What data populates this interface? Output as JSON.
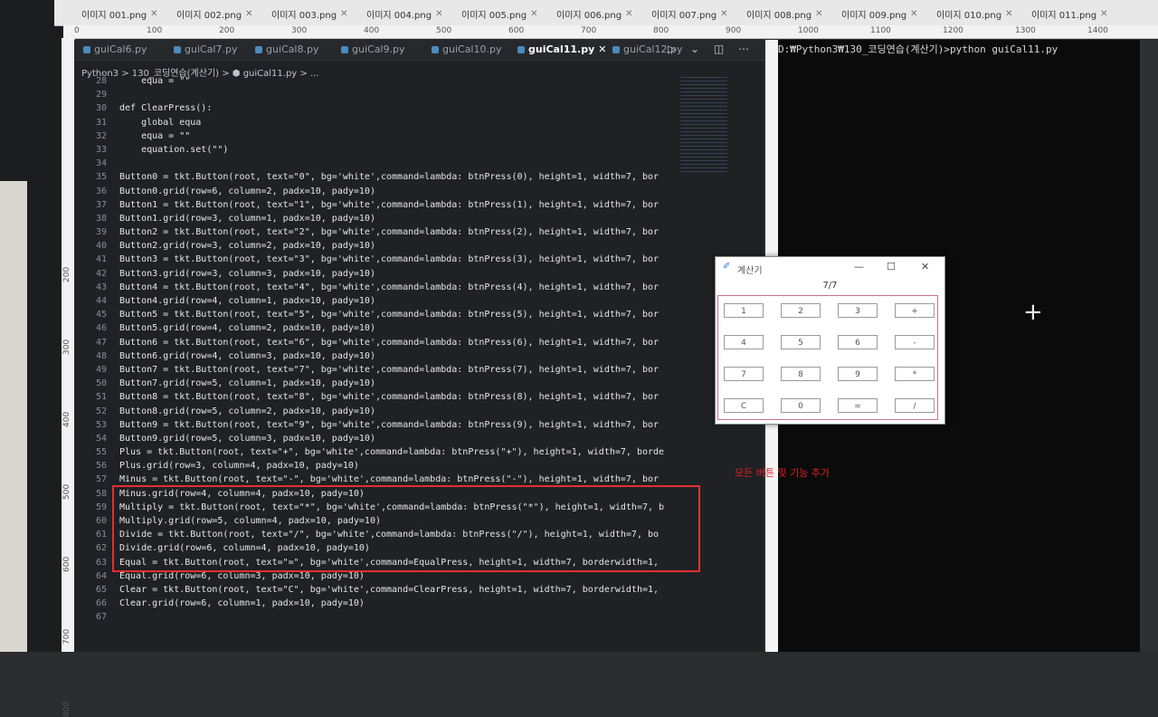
{
  "image_tabs": [
    {
      "label": "이미지 001.png"
    },
    {
      "label": "이미지 002.png"
    },
    {
      "label": "이미지 003.png"
    },
    {
      "label": "이미지 004.png"
    },
    {
      "label": "이미지 005.png"
    },
    {
      "label": "이미지 006.png"
    },
    {
      "label": "이미지 007.png"
    },
    {
      "label": "이미지 008.png"
    },
    {
      "label": "이미지 009.png"
    },
    {
      "label": "이미지 010.png"
    },
    {
      "label": "이미지 011.png"
    }
  ],
  "ruler": {
    "ticks": [
      "0",
      "100",
      "200",
      "300",
      "400",
      "500",
      "600",
      "700",
      "800",
      "900",
      "1000",
      "1100",
      "1200",
      "1300",
      "1400"
    ]
  },
  "vruler": {
    "ticks": [
      "200",
      "300",
      "400",
      "500",
      "600",
      "700",
      "800"
    ]
  },
  "editor": {
    "tabs": [
      {
        "label": "guiCal6.py"
      },
      {
        "label": "guiCal7.py"
      },
      {
        "label": "guiCal8.py"
      },
      {
        "label": "guiCal9.py"
      },
      {
        "label": "guiCal10.py"
      },
      {
        "label": "guiCal11.py",
        "active": true
      },
      {
        "label": "guiCal12.py"
      }
    ],
    "actions": "▷ ⌄ ◫ ⋯",
    "breadcrumb": "Python3 > 130_코딩연습(계산기) > ⬢ guiCal11.py > ...",
    "lines": [
      {
        "n": "28",
        "t": "    equa = \"\""
      },
      {
        "n": "29",
        "t": ""
      },
      {
        "n": "30",
        "t": "def ClearPress():"
      },
      {
        "n": "31",
        "t": "    global equa"
      },
      {
        "n": "32",
        "t": "    equa = \"\""
      },
      {
        "n": "33",
        "t": "    equation.set(\"\")"
      },
      {
        "n": "34",
        "t": ""
      },
      {
        "n": "35",
        "t": "Button0 = tkt.Button(root, text=\"0\", bg='white',command=lambda: btnPress(0), height=1, width=7, bor"
      },
      {
        "n": "36",
        "t": "Button0.grid(row=6, column=2, padx=10, pady=10)"
      },
      {
        "n": "37",
        "t": "Button1 = tkt.Button(root, text=\"1\", bg='white',command=lambda: btnPress(1), height=1, width=7, bor"
      },
      {
        "n": "38",
        "t": "Button1.grid(row=3, column=1, padx=10, pady=10)"
      },
      {
        "n": "39",
        "t": "Button2 = tkt.Button(root, text=\"2\", bg='white',command=lambda: btnPress(2), height=1, width=7, bor"
      },
      {
        "n": "40",
        "t": "Button2.grid(row=3, column=2, padx=10, pady=10)"
      },
      {
        "n": "41",
        "t": "Button3 = tkt.Button(root, text=\"3\", bg='white',command=lambda: btnPress(3), height=1, width=7, bor"
      },
      {
        "n": "42",
        "t": "Button3.grid(row=3, column=3, padx=10, pady=10)"
      },
      {
        "n": "43",
        "t": "Button4 = tkt.Button(root, text=\"4\", bg='white',command=lambda: btnPress(4), height=1, width=7, bor"
      },
      {
        "n": "44",
        "t": "Button4.grid(row=4, column=1, padx=10, pady=10)"
      },
      {
        "n": "45",
        "t": "Button5 = tkt.Button(root, text=\"5\", bg='white',command=lambda: btnPress(5), height=1, width=7, bor"
      },
      {
        "n": "46",
        "t": "Button5.grid(row=4, column=2, padx=10, pady=10)"
      },
      {
        "n": "47",
        "t": "Button6 = tkt.Button(root, text=\"6\", bg='white',command=lambda: btnPress(6), height=1, width=7, bor"
      },
      {
        "n": "48",
        "t": "Button6.grid(row=4, column=3, padx=10, pady=10)"
      },
      {
        "n": "49",
        "t": "Button7 = tkt.Button(root, text=\"7\", bg='white',command=lambda: btnPress(7), height=1, width=7, bor"
      },
      {
        "n": "50",
        "t": "Button7.grid(row=5, column=1, padx=10, pady=10)"
      },
      {
        "n": "51",
        "t": "Button8 = tkt.Button(root, text=\"8\", bg='white',command=lambda: btnPress(8), height=1, width=7, bor"
      },
      {
        "n": "52",
        "t": "Button8.grid(row=5, column=2, padx=10, pady=10)"
      },
      {
        "n": "53",
        "t": "Button9 = tkt.Button(root, text=\"9\", bg='white',command=lambda: btnPress(9), height=1, width=7, bor"
      },
      {
        "n": "54",
        "t": "Button9.grid(row=5, column=3, padx=10, pady=10)"
      },
      {
        "n": "55",
        "t": "Plus = tkt.Button(root, text=\"+\", bg='white',command=lambda: btnPress(\"+\"), height=1, width=7, borde"
      },
      {
        "n": "56",
        "t": "Plus.grid(row=3, column=4, padx=10, pady=10)"
      },
      {
        "n": "57",
        "t": "Minus = tkt.Button(root, text=\"-\", bg='white',command=lambda: btnPress(\"-\"), height=1, width=7, bor"
      },
      {
        "n": "58",
        "t": "Minus.grid(row=4, column=4, padx=10, pady=10)"
      },
      {
        "n": "59",
        "t": "Multiply = tkt.Button(root, text=\"*\", bg='white',command=lambda: btnPress(\"*\"), height=1, width=7, b"
      },
      {
        "n": "60",
        "t": "Multiply.grid(row=5, column=4, padx=10, pady=10)"
      },
      {
        "n": "61",
        "t": "Divide = tkt.Button(root, text=\"/\", bg='white',command=lambda: btnPress(\"/\"), height=1, width=7, bo"
      },
      {
        "n": "62",
        "t": "Divide.grid(row=6, column=4, padx=10, pady=10)"
      },
      {
        "n": "63",
        "t": "Equal = tkt.Button(root, text=\"=\", bg='white',command=EqualPress, height=1, width=7, borderwidth=1,"
      },
      {
        "n": "64",
        "t": "Equal.grid(row=6, column=3, padx=10, pady=10)"
      },
      {
        "n": "65",
        "t": "Clear = tkt.Button(root, text=\"C\", bg='white',command=ClearPress, height=1, width=7, borderwidth=1,"
      },
      {
        "n": "66",
        "t": "Clear.grid(row=6, column=1, padx=10, pady=10)"
      },
      {
        "n": "67",
        "t": ""
      }
    ]
  },
  "terminal": {
    "text": "D:₩Python3₩130_코딩연습(계산기)>python guiCal11.py"
  },
  "calculator": {
    "title": "계산기",
    "window_buttons": [
      "—",
      "☐",
      "✕"
    ],
    "display": "7/7",
    "keys": [
      [
        "1",
        "2",
        "3",
        "+"
      ],
      [
        "4",
        "5",
        "6",
        "-"
      ],
      [
        "7",
        "8",
        "9",
        "*"
      ],
      [
        "C",
        "0",
        "=",
        "/"
      ]
    ]
  },
  "annotation": "모든 버튼 및 기능 추가",
  "colors": {
    "highlight": "#e03030",
    "annotation": "#e02020",
    "grid_border": "#d07090"
  }
}
